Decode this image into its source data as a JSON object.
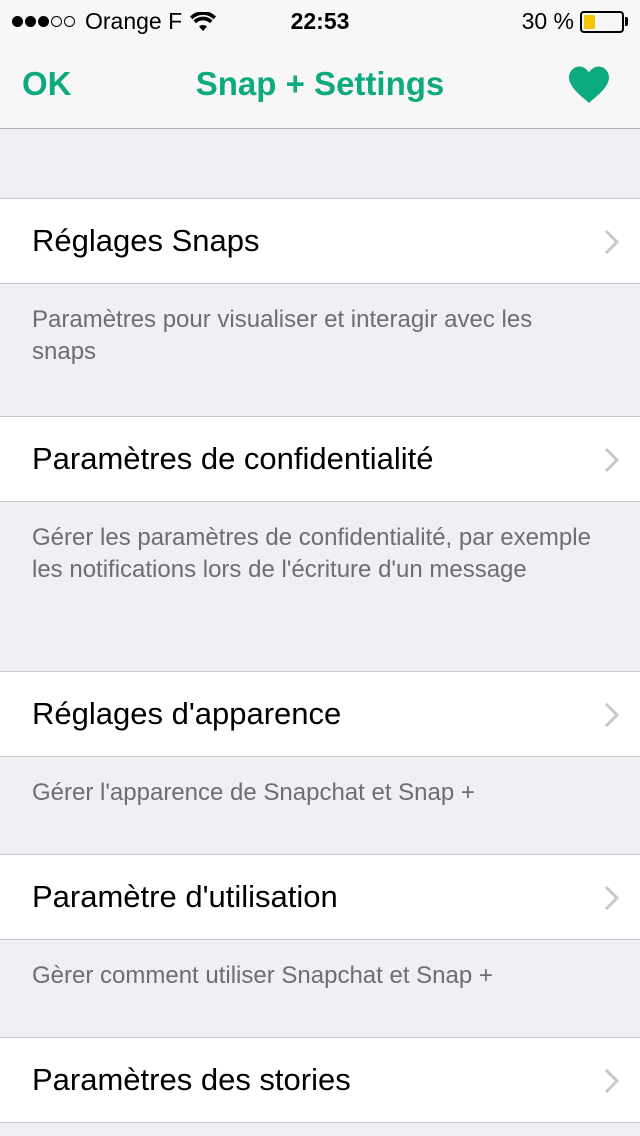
{
  "status_bar": {
    "carrier": "Orange F",
    "time": "22:53",
    "battery": "30 %",
    "battery_level": 0.3,
    "signal_full": 3,
    "signal_total": 5
  },
  "nav": {
    "ok_label": "OK",
    "title": "Snap + Settings",
    "heart_icon": "heart-icon"
  },
  "colors": {
    "accent": "#0eaa7f",
    "background": "#efeff4",
    "battery": "#f5c400"
  },
  "sections": [
    {
      "label": "Réglages Snaps",
      "footer": "Paramètres pour visualiser et interagir avec les snaps"
    },
    {
      "label": "Paramètres de confidentialité",
      "footer": "Gérer les paramètres de confidentialité, par exemple les notifications lors de l'écriture d'un message"
    },
    {
      "label": "Réglages d'apparence",
      "footer": "Gérer l'apparence de Snapchat et Snap +"
    },
    {
      "label": "Paramètre d'utilisation",
      "footer": "Gèrer comment utiliser Snapchat et Snap +"
    },
    {
      "label": "Paramètres des stories",
      "footer": ""
    }
  ]
}
